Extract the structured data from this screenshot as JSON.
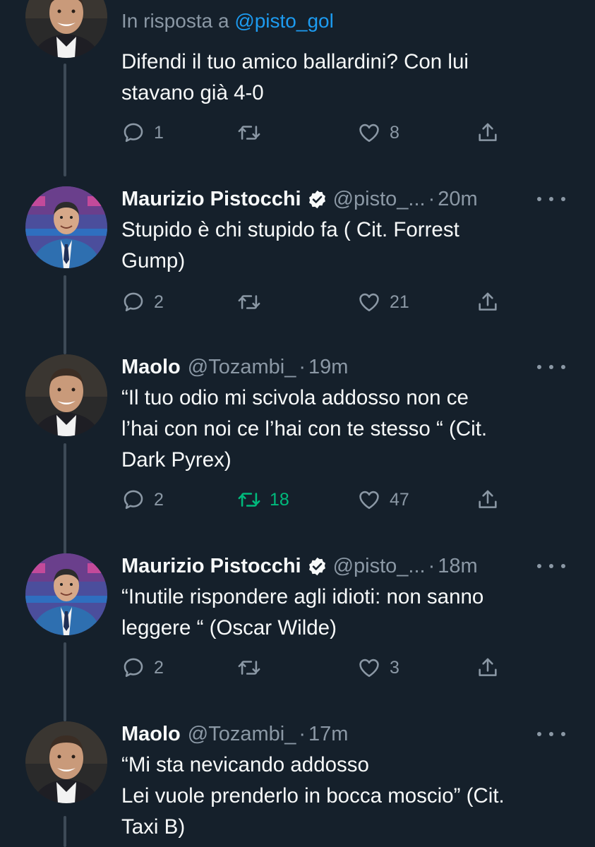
{
  "tweets": [
    {
      "reply_prefix": "In risposta a ",
      "reply_handle": "@pisto_gol",
      "text": "Difendi il tuo amico ballardini? Con lui\nstavano già 4-0",
      "replies": "1",
      "retweets": "",
      "likes": "8"
    },
    {
      "name": "Maurizio Pistocchi",
      "handle": "@pisto_...",
      "time": "20m",
      "text": "Stupido è chi stupido fa ( Cit. Forrest\nGump)",
      "replies": "2",
      "retweets": "",
      "likes": "21"
    },
    {
      "name": "Maolo",
      "handle": "@Tozambi_",
      "time": "19m",
      "text": "“Il tuo odio mi scivola addosso non ce\nl’hai con noi ce l’hai con te stesso “ (Cit.\nDark Pyrex)",
      "replies": "2",
      "retweets": "18",
      "likes": "47"
    },
    {
      "name": "Maurizio Pistocchi",
      "handle": "@pisto_...",
      "time": "18m",
      "text": "“Inutile rispondere agli idioti: non sanno\nleggere “ (Oscar Wilde)",
      "replies": "2",
      "retweets": "",
      "likes": "3"
    },
    {
      "name": "Maolo",
      "handle": "@Tozambi_",
      "time": "17m",
      "text": "“Mi sta nevicando addosso\nLei vuole prenderlo in bocca moscio” (Cit.\nTaxi B)"
    }
  ],
  "separator": "·",
  "colors": {
    "background": "#15202b",
    "text": "#f7f9f9",
    "secondary": "#8b98a5",
    "link": "#1d9bf0",
    "retweeted": "#00ba7c",
    "verified": "#f7f9f9"
  },
  "icons": [
    "reply-icon",
    "retweet-icon",
    "like-icon",
    "share-icon",
    "verified-badge-icon",
    "more-icon"
  ]
}
